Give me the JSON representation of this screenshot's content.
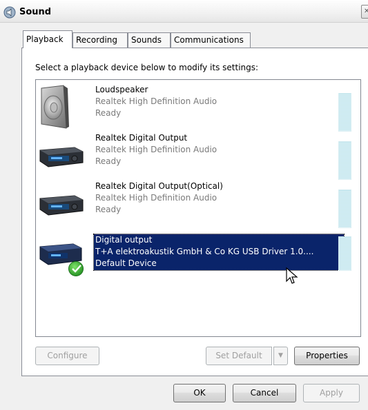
{
  "window": {
    "title": "Sound"
  },
  "tabs": [
    {
      "label": "Playback",
      "active": true
    },
    {
      "label": "Recording",
      "active": false
    },
    {
      "label": "Sounds",
      "active": false
    },
    {
      "label": "Communications",
      "active": false
    }
  ],
  "instruction": "Select a playback device below to modify its settings:",
  "devices": [
    {
      "name": "Loudspeaker",
      "driver": "Realtek High Definition Audio",
      "status": "Ready",
      "icon": "speaker-icon",
      "selected": false,
      "default": false
    },
    {
      "name": "Realtek Digital Output",
      "driver": "Realtek High Definition Audio",
      "status": "Ready",
      "icon": "digital-output-icon",
      "selected": false,
      "default": false
    },
    {
      "name": "Realtek Digital Output(Optical)",
      "driver": "Realtek High Definition Audio",
      "status": "Ready",
      "icon": "digital-output-icon",
      "selected": false,
      "default": false
    },
    {
      "name": "Digital output",
      "driver": "T+A elektroakustik GmbH & Co KG USB Driver 1.0....",
      "status": "Default Device",
      "icon": "digital-output-icon",
      "selected": true,
      "default": true
    }
  ],
  "buttons": {
    "configure": "Configure",
    "set_default": "Set Default",
    "set_default_arrow": "▼",
    "properties": "Properties",
    "ok": "OK",
    "cancel": "Cancel",
    "apply": "Apply"
  },
  "colors": {
    "selection": "#0a246a",
    "secondary_text": "#7a7a7a",
    "default_check": "#2f9a2a"
  }
}
